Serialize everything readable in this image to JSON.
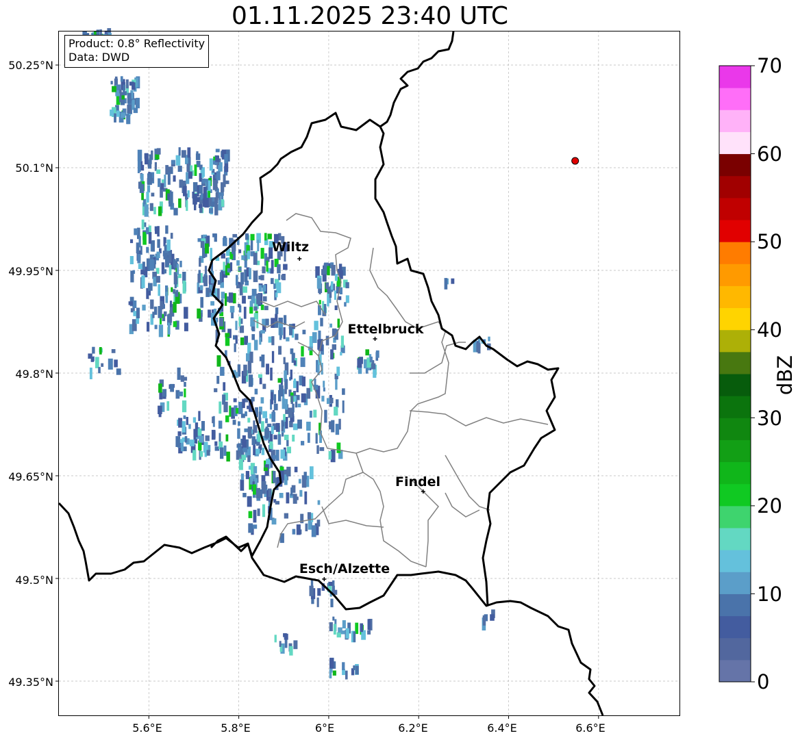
{
  "title": "01.11.2025 23:40 UTC",
  "info_box": {
    "product": "Product: 0.8° Reflectivity",
    "data_source": "Data: DWD"
  },
  "axes": {
    "lat_labels": [
      "50.25°N",
      "50.1°N",
      "49.95°N",
      "49.8°N",
      "49.65°N",
      "49.5°N",
      "49.35°N"
    ],
    "lon_labels": [
      "5.6°E",
      "5.8°E",
      "6°E",
      "6.2°E",
      "6.4°E",
      "6.6°E"
    ],
    "extent": {
      "lon_min": 5.4,
      "lon_max": 6.78,
      "lat_min": 49.3,
      "lat_max": 50.3
    },
    "grid": true
  },
  "cities": [
    {
      "name": "Wiltz",
      "lon": 5.935,
      "lat": 49.967
    },
    {
      "name": "Ettelbruck",
      "lon": 6.103,
      "lat": 49.85
    },
    {
      "name": "Findel",
      "lon": 6.21,
      "lat": 49.627
    },
    {
      "name": "Esch/Alzette",
      "lon": 5.99,
      "lat": 49.499
    }
  ],
  "radar_site": {
    "lon": 6.548,
    "lat": 50.11,
    "color": "#e00000"
  },
  "colorbar": {
    "label": "dBZ",
    "min": 0,
    "max": 70,
    "ticks": [
      "0",
      "10",
      "20",
      "30",
      "40",
      "50",
      "60",
      "70"
    ],
    "colors": [
      "#6574a8",
      "#52679e",
      "#435c9f",
      "#4a73aa",
      "#5b9ec9",
      "#64c1dc",
      "#63d8c2",
      "#3ed46e",
      "#10c922",
      "#10b61a",
      "#129f15",
      "#108710",
      "#0b740d",
      "#075c0c",
      "#487810",
      "#adb007",
      "#ffd400",
      "#ffb800",
      "#ff9a00",
      "#ff7c00",
      "#e10000",
      "#c00000",
      "#a10000",
      "#7a0000",
      "#ffe2fa",
      "#ffb2f8",
      "#ff6ef8",
      "#ea38ea"
    ]
  }
}
